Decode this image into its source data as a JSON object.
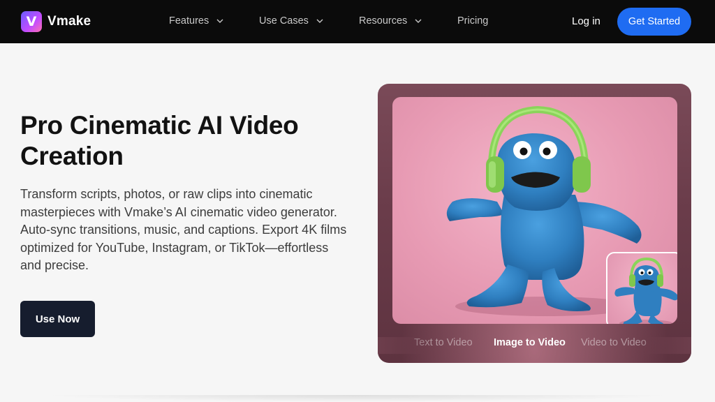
{
  "nav": {
    "brand": "Vmake",
    "logo_letter": "V",
    "menu": [
      {
        "label": "Features",
        "has_dropdown": true
      },
      {
        "label": "Use Cases",
        "has_dropdown": true
      },
      {
        "label": "Resources",
        "has_dropdown": true
      },
      {
        "label": "Pricing",
        "has_dropdown": false
      }
    ],
    "login_label": "Log in",
    "cta_label": "Get Started"
  },
  "hero": {
    "title": "Pro Cinematic AI Video Creation",
    "description": "Transform scripts, photos, or raw clips into cinematic masterpieces with Vmake’s AI cinematic video generator. Auto-sync transitions, music, and captions. Export 4K films optimized for YouTube, Instagram, or TikTok—effortless and precise.",
    "button_label": "Use Now"
  },
  "showcase": {
    "tabs": [
      {
        "label": "Text to Video",
        "active": false
      },
      {
        "label": "Image to Video",
        "active": true
      },
      {
        "label": "Video to Video",
        "active": false
      }
    ]
  },
  "colors": {
    "nav_bg": "#0b0b0b",
    "cta_blue": "#1f6cf2",
    "use_now_bg": "#161d2e",
    "monster_blue": "#2f7fc0",
    "headphones_green": "#8ad45a"
  }
}
